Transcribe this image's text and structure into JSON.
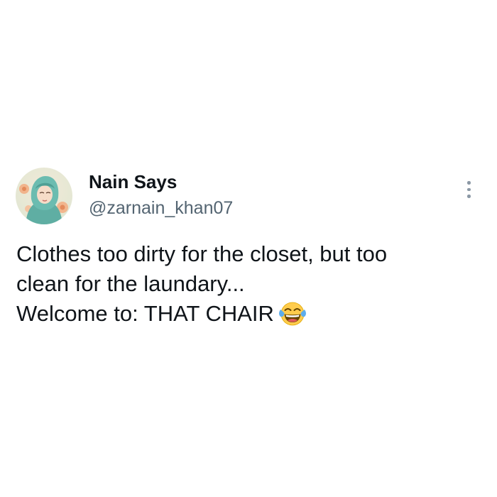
{
  "tweet": {
    "author": {
      "display_name": "Nain Says",
      "handle": "@zarnain_khan07",
      "avatar": "avatar-image"
    },
    "more_menu_icon": "more-vertical-icon",
    "text_lines": [
      "Clothes too dirty for the closet, but too",
      "clean for the laundary...",
      "Welcome to: THAT CHAIR"
    ],
    "emoji": "face-with-tears-of-joy",
    "colors": {
      "text": "#0f1419",
      "secondary_text": "#536471",
      "background": "#ffffff",
      "menu_dots": "#8b98a5"
    }
  }
}
